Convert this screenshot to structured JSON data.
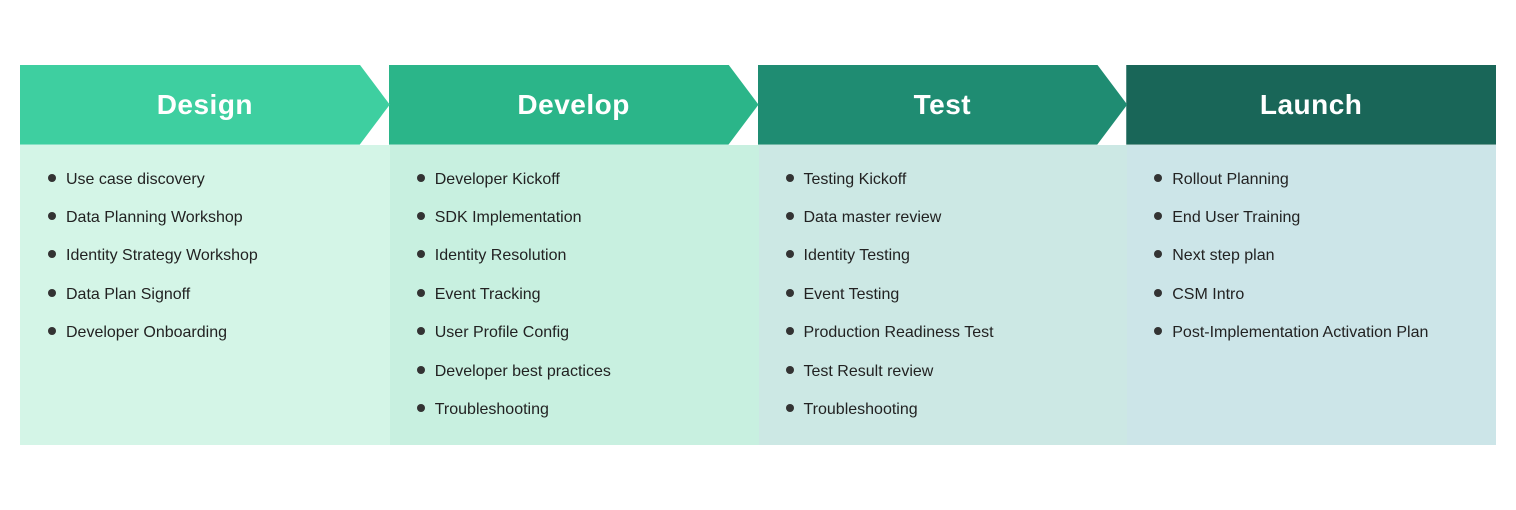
{
  "phases": [
    {
      "id": "design",
      "title": "Design",
      "items": [
        "Use case discovery",
        "Data Planning Workshop",
        "Identity Strategy Workshop",
        "Data Plan Signoff",
        "Developer Onboarding"
      ]
    },
    {
      "id": "develop",
      "title": "Develop",
      "items": [
        "Developer Kickoff",
        "SDK  Implementation",
        "Identity Resolution",
        "Event Tracking",
        "User Profile Config",
        "Developer best practices",
        "Troubleshooting"
      ]
    },
    {
      "id": "test",
      "title": "Test",
      "items": [
        "Testing Kickoff",
        "Data master review",
        "Identity Testing",
        "Event Testing",
        "Production Readiness Test",
        "Test Result review",
        "Troubleshooting"
      ]
    },
    {
      "id": "launch",
      "title": "Launch",
      "items": [
        "Rollout Planning",
        "End User Training",
        "Next step plan",
        "CSM Intro",
        "Post-Implementation Activation Plan"
      ]
    }
  ]
}
